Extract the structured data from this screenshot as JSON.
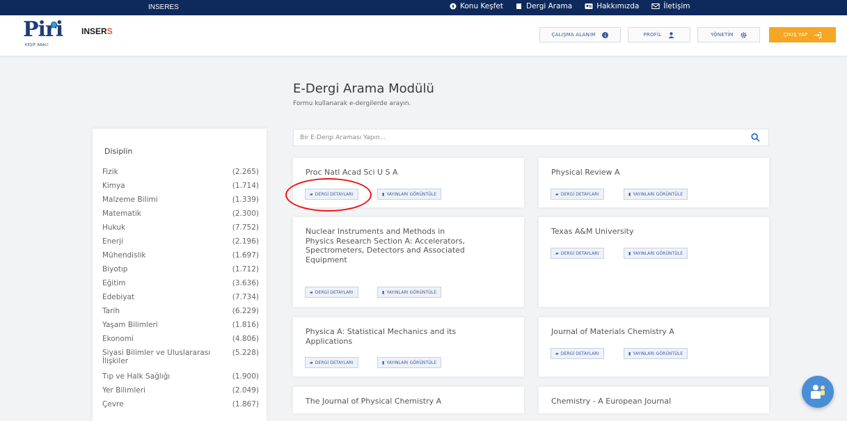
{
  "topbar": {
    "brand": "INSERES",
    "nav": [
      {
        "label": "Konu Keşfet",
        "icon": "compass-icon"
      },
      {
        "label": "Dergi Arama",
        "icon": "book-icon"
      },
      {
        "label": "Hakkımızda",
        "icon": "id-card-icon"
      },
      {
        "label": "İletişim",
        "icon": "envelope-icon"
      }
    ]
  },
  "header": {
    "logo_text": "Piri",
    "logo_sub": "KEŞİF ARACI",
    "inser_text": "INSER",
    "inser_suffix": "S",
    "buttons": {
      "workspace": "ÇALIŞMA ALANIM",
      "profile": "PROFİL",
      "admin": "YÖNETİM",
      "logout": "ÇIKIŞ YAP"
    }
  },
  "page": {
    "title": "E-Dergi Arama Modülü",
    "subtitle": "Formu kullanarak e-dergilerde arayın."
  },
  "search": {
    "placeholder": "Bir E-Dergi Araması Yapın..."
  },
  "sidebar": {
    "heading": "Disiplin",
    "items": [
      {
        "name": "Fizik",
        "count": "(2.265)"
      },
      {
        "name": "Kimya",
        "count": "(1.714)"
      },
      {
        "name": "Malzeme Bilimi",
        "count": "(1.339)"
      },
      {
        "name": "Matematik",
        "count": "(2.300)"
      },
      {
        "name": "Hukuk",
        "count": "(7.752)"
      },
      {
        "name": "Enerji",
        "count": "(2.196)"
      },
      {
        "name": "Mühendislik",
        "count": "(1.697)"
      },
      {
        "name": "Biyotıp",
        "count": "(1.712)"
      },
      {
        "name": "Eğitim",
        "count": "(3.636)"
      },
      {
        "name": "Edebiyat",
        "count": "(7.734)"
      },
      {
        "name": "Tarih",
        "count": "(6.229)"
      },
      {
        "name": "Yaşam Bilimleri",
        "count": "(1.816)"
      },
      {
        "name": "Ekonomi",
        "count": "(4.806)"
      },
      {
        "name": "Siyasi Bilimler ve Uluslararası İlişkiler",
        "count": "(5.228)"
      },
      {
        "name": "Tıp ve Halk Sağlığı",
        "count": "(1.900)"
      },
      {
        "name": "Yer Bilimleri",
        "count": "(2.049)"
      },
      {
        "name": "Çevre",
        "count": "(1.867)"
      }
    ]
  },
  "buttons": {
    "details": "DERGİ DETAYLARI",
    "publications": "YAYINLARI GÖRÜNTÜLE"
  },
  "journals": [
    {
      "title": "Proc Natl Acad Sci U S A"
    },
    {
      "title": "Physical Review A"
    },
    {
      "title": "Nuclear Instruments and Methods in Physics Research Section A: Accelerators, Spectrometers, Detectors and Associated Equipment"
    },
    {
      "title": "Texas A&M University"
    },
    {
      "title": "Physica A: Statistical Mechanics and its Applications"
    },
    {
      "title": "Journal of Materials Chemistry A"
    },
    {
      "title": "The Journal of Physical Chemistry A"
    },
    {
      "title": "Chemistry - A European Journal"
    }
  ]
}
